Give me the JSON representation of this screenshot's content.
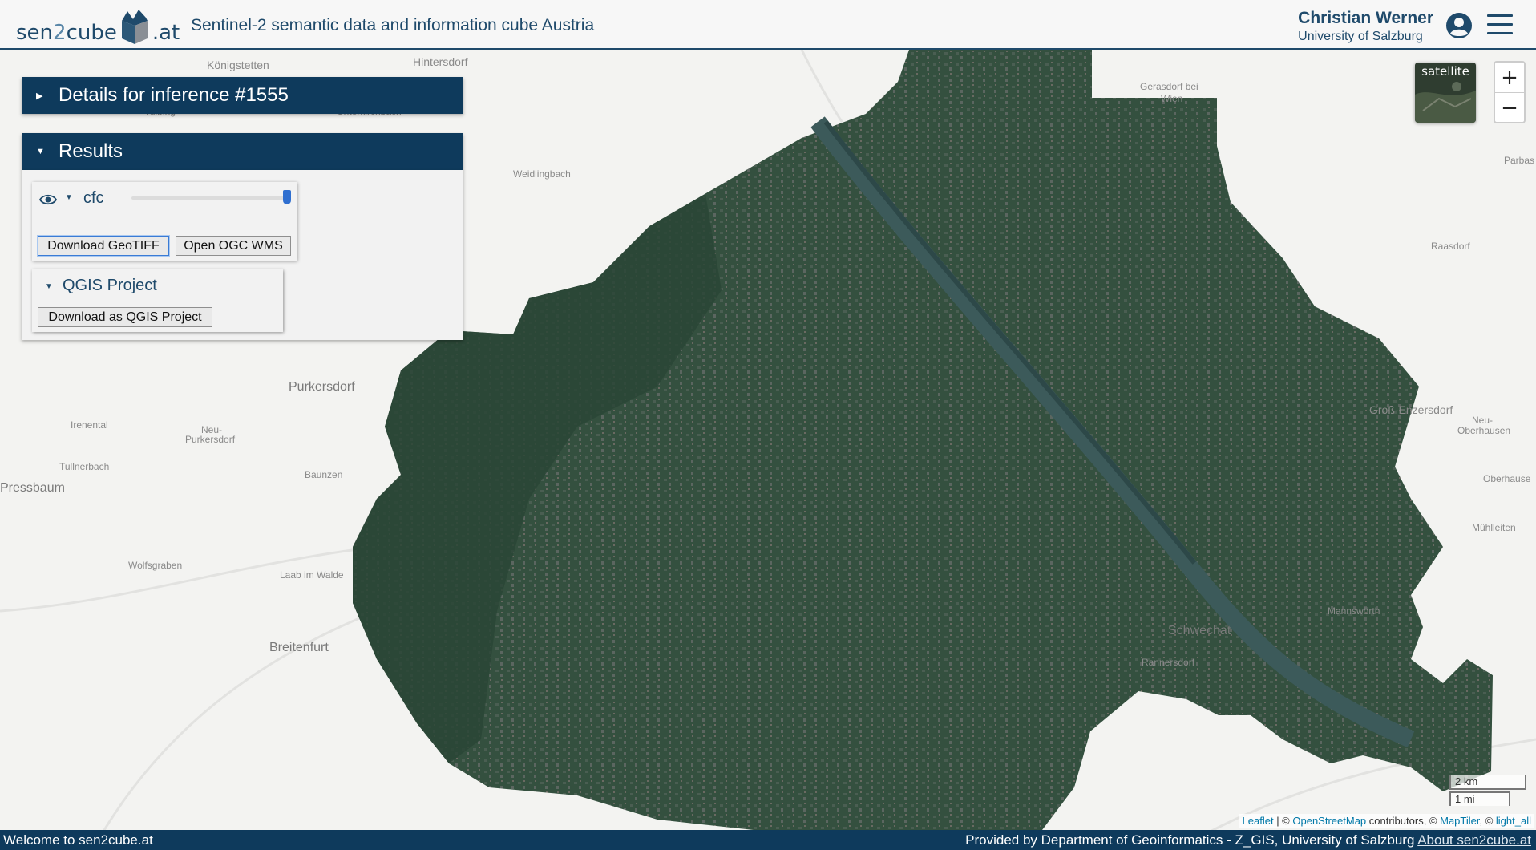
{
  "header": {
    "logo_part1": "sen",
    "logo_part2": "2",
    "logo_part3": "cube",
    "logo_part4": ".at",
    "title": "Sentinel-2 semantic data and information cube Austria",
    "user_name": "Christian Werner",
    "user_org": "University of Salzburg"
  },
  "panels": {
    "details_title": "Details for inference #1555",
    "results_title": "Results",
    "layer": {
      "name": "cfc",
      "opacity_percent": 100,
      "download_geotiff": "Download GeoTIFF",
      "open_ogc_wms": "Open OGC WMS"
    },
    "qgis": {
      "title": "QGIS Project",
      "download": "Download as QGIS Project"
    }
  },
  "map": {
    "layer_switch_label": "satellite",
    "zoom_in": "+",
    "zoom_out": "−",
    "scale_km": "2 km",
    "scale_mi": "1 mi",
    "places": [
      {
        "id": "konigstetten",
        "label": "Königstetten"
      },
      {
        "id": "hintersdorf",
        "label": "Hintersdorf"
      },
      {
        "id": "tulbing",
        "label": "Tulbing"
      },
      {
        "id": "unterkirchbach",
        "label": "Unterkirchbach"
      },
      {
        "id": "gerasdorf",
        "label": "Gerasdorf bei"
      },
      {
        "id": "wien",
        "label": "Wien"
      },
      {
        "id": "parbas",
        "label": "Parbas"
      },
      {
        "id": "weidlingbach",
        "label": "Weidlingbach"
      },
      {
        "id": "raasdorf",
        "label": "Raasdorf"
      },
      {
        "id": "purkersdorf",
        "label": "Purkersdorf"
      },
      {
        "id": "irenental",
        "label": "Irenental"
      },
      {
        "id": "neu",
        "label": "Neu-"
      },
      {
        "id": "neupurkersdorf",
        "label": "Purkersdorf"
      },
      {
        "id": "tullnerbach",
        "label": "Tullnerbach"
      },
      {
        "id": "pressbaum",
        "label": "Pressbaum"
      },
      {
        "id": "baunzen",
        "label": "Baunzen"
      },
      {
        "id": "wolfsgraben",
        "label": "Wolfsgraben"
      },
      {
        "id": "laab",
        "label": "Laab im Walde"
      },
      {
        "id": "breitenfurt",
        "label": "Breitenfurt"
      },
      {
        "id": "gross",
        "label": "Groß-Enzersdorf"
      },
      {
        "id": "neuober",
        "label": "Neu-"
      },
      {
        "id": "oberhausen",
        "label": "Oberhausen"
      },
      {
        "id": "oberhause2",
        "label": "Oberhause"
      },
      {
        "id": "muhlleiten",
        "label": "Mühlleiten"
      },
      {
        "id": "mannsworth",
        "label": "Mannswörth"
      },
      {
        "id": "schwechat",
        "label": "Schwechat"
      },
      {
        "id": "rannersdorf",
        "label": "Rannersdorf"
      }
    ],
    "attribution": {
      "leaflet": "Leaflet",
      "sep1": " | © ",
      "osm": "OpenStreetMap",
      "mid": " contributors, © ",
      "maptiler": "MapTiler",
      "sep2": ", © ",
      "light": "light_all"
    }
  },
  "footer": {
    "welcome": "Welcome to sen2cube.at",
    "provided_by": "Provided by Department of Geoinformatics - Z_GIS, University of Salzburg ",
    "about_link": "About sen2cube.at"
  },
  "colors": {
    "brand": "#0e3a5c",
    "accent": "#2f6fd0",
    "imagery": "#2f4a3e"
  }
}
